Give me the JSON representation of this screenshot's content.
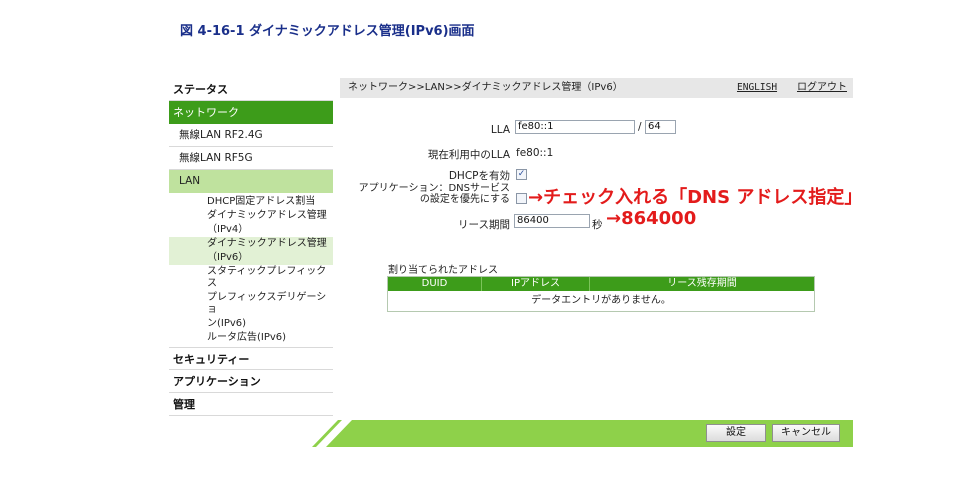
{
  "caption": "図 4-16-1 ダイナミックアドレス管理(IPv6)画面",
  "sidebar": {
    "status": "ステータス",
    "network": "ネットワーク",
    "wlan24": "無線LAN RF2.4G",
    "wlan5": "無線LAN RF5G",
    "lan": "LAN",
    "lan_items": [
      "DHCP固定アドレス割当",
      "ダイナミックアドレス管理",
      "（IPv4）",
      "ダイナミックアドレス管理",
      "（IPv6）",
      "スタティックプレフィックス",
      "プレフィックスデリゲーショ",
      "ン(IPv6)",
      "ルータ広告(IPv6)"
    ],
    "security": "セキュリティー",
    "application": "アプリケーション",
    "admin": "管理"
  },
  "topbar": {
    "breadcrumb": "ネットワーク>>LAN>>ダイナミックアドレス管理（IPv6）",
    "english": "ENGLISH",
    "logout": "ログアウト"
  },
  "form": {
    "lla_label": "LLA",
    "lla_value": "fe80::1",
    "slash": "/",
    "prefix_value": "64",
    "current_lla_label": "現在利用中のLLA",
    "current_lla_value": "fe80::1",
    "dhcp_label": "DHCPを有効",
    "dhcp_checked": true,
    "app_dns_label_1": "アプリケーション：DNSサービス",
    "app_dns_label_2": "の設定を優先にする",
    "app_dns_checked": false,
    "lease_label": "リース期間",
    "lease_value": "86400",
    "lease_unit": "秒"
  },
  "annotations": {
    "dns_note": "→チェック入れる「DNS アドレス指定」",
    "lease_note": "→864000",
    "color": "#e31b1b"
  },
  "table": {
    "title": "割り当てられたアドレス",
    "headers": [
      "DUID",
      "IPアドレス",
      "リース残存期間"
    ],
    "empty": "データエントリがありません。"
  },
  "buttons": {
    "save": "設定",
    "cancel": "キャンセル"
  },
  "colors": {
    "accent_green": "#3d9c1a",
    "light_green": "#bfe29e",
    "stripe_green": "#8ed14a"
  }
}
